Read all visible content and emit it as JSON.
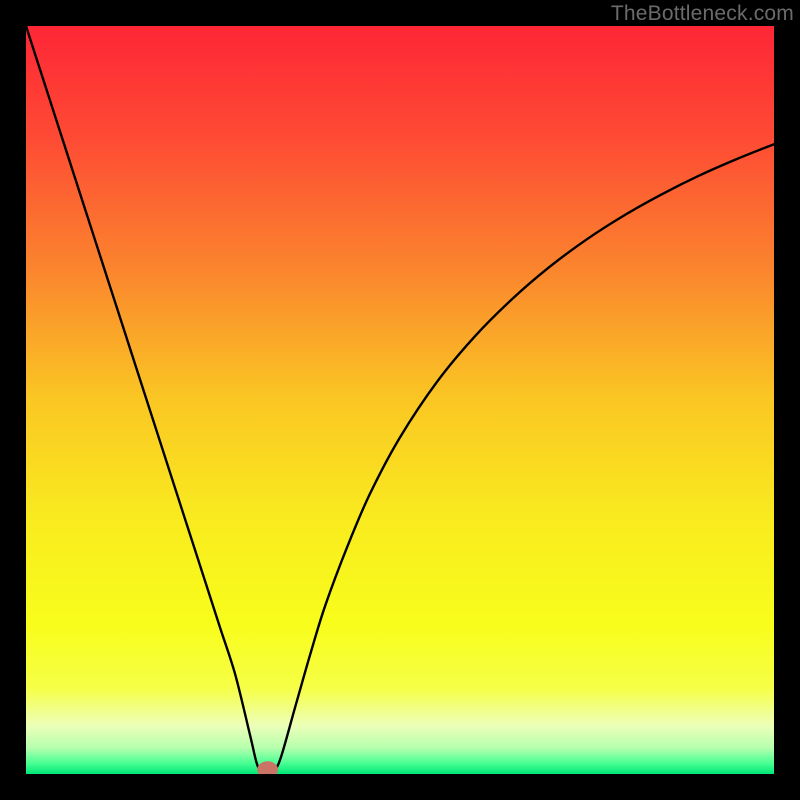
{
  "watermark": "TheBottleneck.com",
  "chart_data": {
    "type": "line",
    "title": "",
    "xlabel": "",
    "ylabel": "",
    "xlim": [
      0,
      100
    ],
    "ylim": [
      0,
      100
    ],
    "gradient_stops": [
      {
        "offset": 0.0,
        "color": "#fe2636"
      },
      {
        "offset": 0.15,
        "color": "#fe4b34"
      },
      {
        "offset": 0.32,
        "color": "#fb832e"
      },
      {
        "offset": 0.5,
        "color": "#fac723"
      },
      {
        "offset": 0.66,
        "color": "#f9eb1f"
      },
      {
        "offset": 0.8,
        "color": "#f8fd1b"
      },
      {
        "offset": 0.885,
        "color": "#f6ff46"
      },
      {
        "offset": 0.935,
        "color": "#edffb8"
      },
      {
        "offset": 0.965,
        "color": "#b6ffae"
      },
      {
        "offset": 0.985,
        "color": "#4cff94"
      },
      {
        "offset": 1.0,
        "color": "#00e777"
      }
    ],
    "series": [
      {
        "name": "bottleneck-curve",
        "x": [
          0,
          2,
          4,
          6,
          8,
          10,
          12,
          14,
          16,
          18,
          20,
          22,
          24,
          26,
          28,
          30,
          31,
          32,
          33,
          34,
          36,
          38,
          40,
          43,
          46,
          50,
          55,
          60,
          65,
          70,
          75,
          80,
          85,
          90,
          95,
          100
        ],
        "y": [
          100,
          93.8,
          87.6,
          81.4,
          75.2,
          69.0,
          62.8,
          56.6,
          50.4,
          44.2,
          38.0,
          31.8,
          25.6,
          19.4,
          13.2,
          5.0,
          1.0,
          0.4,
          0.4,
          2.0,
          9.0,
          16.0,
          22.5,
          30.5,
          37.5,
          45.0,
          52.5,
          58.5,
          63.5,
          67.8,
          71.5,
          74.7,
          77.5,
          80.0,
          82.2,
          84.2
        ]
      }
    ],
    "marker": {
      "x": 32.3,
      "y": 0.6,
      "rx": 1.4,
      "ry": 1.1,
      "color": "#ca7465"
    },
    "curve_color": "#000000",
    "curve_width": 2.4
  }
}
